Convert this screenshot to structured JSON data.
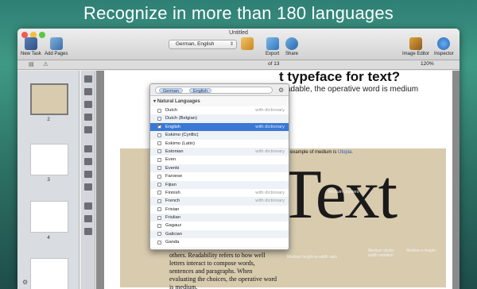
{
  "headline": "Recognize in more than 180 languages",
  "window": {
    "title": "Untitled",
    "toolbar": {
      "new_task": "New Task",
      "add_pages": "Add Pages",
      "export": "Export",
      "share": "Share",
      "image_editor": "Image Editor",
      "inspector": "Inspector"
    },
    "language_select_value": "German, English",
    "page_count": "of 13",
    "zoom": "120%"
  },
  "sidebar": {
    "page_numbers": [
      "2",
      "3",
      "4"
    ]
  },
  "document": {
    "heading": "t typeface for text?",
    "subheading": "readable, the operative word is medium",
    "example_prefix": "An example of medium is",
    "example_link": "Utopia.",
    "big_word": "Text",
    "body_copy": "others. Readability refers to how well letters interact to compose words, sentences and paragraphs. When evaluating the choices, the operative word is medium.",
    "annotations": {
      "counter": "Medium counters",
      "x_height_ratio": "Medium height-to-width ratio",
      "stroke_variation": "Medium stroke width variation",
      "x_height": "Medium x-height"
    }
  },
  "language_popup": {
    "chips": [
      "German",
      "English"
    ],
    "section_title": "Natural Languages",
    "rows": [
      {
        "label": "Dutch",
        "note": "with dictionary",
        "checked": false,
        "selected": false
      },
      {
        "label": "Dutch (Belgian)",
        "note": "",
        "checked": false,
        "selected": false
      },
      {
        "label": "English",
        "note": "with dictionary",
        "checked": true,
        "selected": true
      },
      {
        "label": "Eskimo (Cyrillic)",
        "note": "",
        "checked": false,
        "selected": false
      },
      {
        "label": "Eskimo (Latin)",
        "note": "",
        "checked": false,
        "selected": false
      },
      {
        "label": "Estonian",
        "note": "with dictionary",
        "checked": false,
        "selected": false
      },
      {
        "label": "Even",
        "note": "",
        "checked": false,
        "selected": false
      },
      {
        "label": "Evenki",
        "note": "",
        "checked": false,
        "selected": false
      },
      {
        "label": "Faroese",
        "note": "",
        "checked": false,
        "selected": false
      },
      {
        "label": "Fijian",
        "note": "",
        "checked": false,
        "selected": false
      },
      {
        "label": "Finnish",
        "note": "with dictionary",
        "checked": false,
        "selected": false
      },
      {
        "label": "French",
        "note": "with dictionary",
        "checked": false,
        "selected": false
      },
      {
        "label": "Frisian",
        "note": "",
        "checked": false,
        "selected": false
      },
      {
        "label": "Friulian",
        "note": "",
        "checked": false,
        "selected": false
      },
      {
        "label": "Gagauz",
        "note": "",
        "checked": false,
        "selected": false
      },
      {
        "label": "Galician",
        "note": "",
        "checked": false,
        "selected": false
      },
      {
        "label": "Ganda",
        "note": "",
        "checked": false,
        "selected": false
      }
    ]
  }
}
